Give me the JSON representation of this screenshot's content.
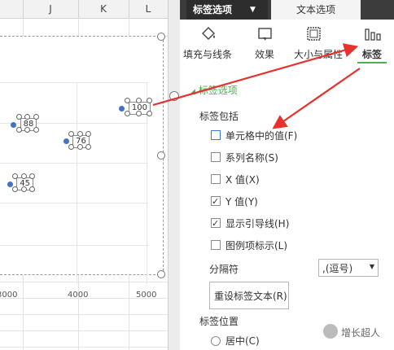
{
  "sheet": {
    "columns": [
      "J",
      "K",
      "L"
    ],
    "x_ticks": [
      "3000",
      "4000",
      "5000"
    ]
  },
  "chart_data": {
    "type": "scatter",
    "points": [
      {
        "x": 4650,
        "y": 100,
        "label": "100"
      },
      {
        "x": 3100,
        "y": 88,
        "label": "88"
      },
      {
        "x": 3850,
        "y": 76,
        "label": "76"
      },
      {
        "x": 3050,
        "y": 45,
        "label": "45"
      }
    ],
    "x_tick_labels": [
      "3000",
      "4000",
      "5000"
    ],
    "point_color": "#4472c4"
  },
  "pane": {
    "tab_label_options": "标签选项",
    "tab_text_options": "文本选项",
    "categories": [
      {
        "label": "填充与线条",
        "icon": "paint-bucket-icon"
      },
      {
        "label": "效果",
        "icon": "effects-icon"
      },
      {
        "label": "大小与属性",
        "icon": "size-properties-icon"
      },
      {
        "label": "标签",
        "icon": "bar-chart-icon"
      }
    ],
    "section_title": "标签选项",
    "label_contains": "标签包括",
    "options": [
      {
        "label": "单元格中的值(F)",
        "checked": false
      },
      {
        "label": "系列名称(S)",
        "checked": false
      },
      {
        "label": "X 值(X)",
        "checked": false
      },
      {
        "label": "Y 值(Y)",
        "checked": true
      },
      {
        "label": "显示引导线(H)",
        "checked": true
      },
      {
        "label": "图例项标示(L)",
        "checked": false
      }
    ],
    "separator_label": "分隔符",
    "separator_value": ",(逗号)",
    "reset_button": "重设标签文本(R)",
    "label_position": "标签位置",
    "position_center": "居中(C)",
    "watermark": "增长超人"
  },
  "colors": {
    "accent_green": "#4caf50",
    "arrow_red": "#e8312b",
    "dark_tab": "#2d2d2d"
  }
}
